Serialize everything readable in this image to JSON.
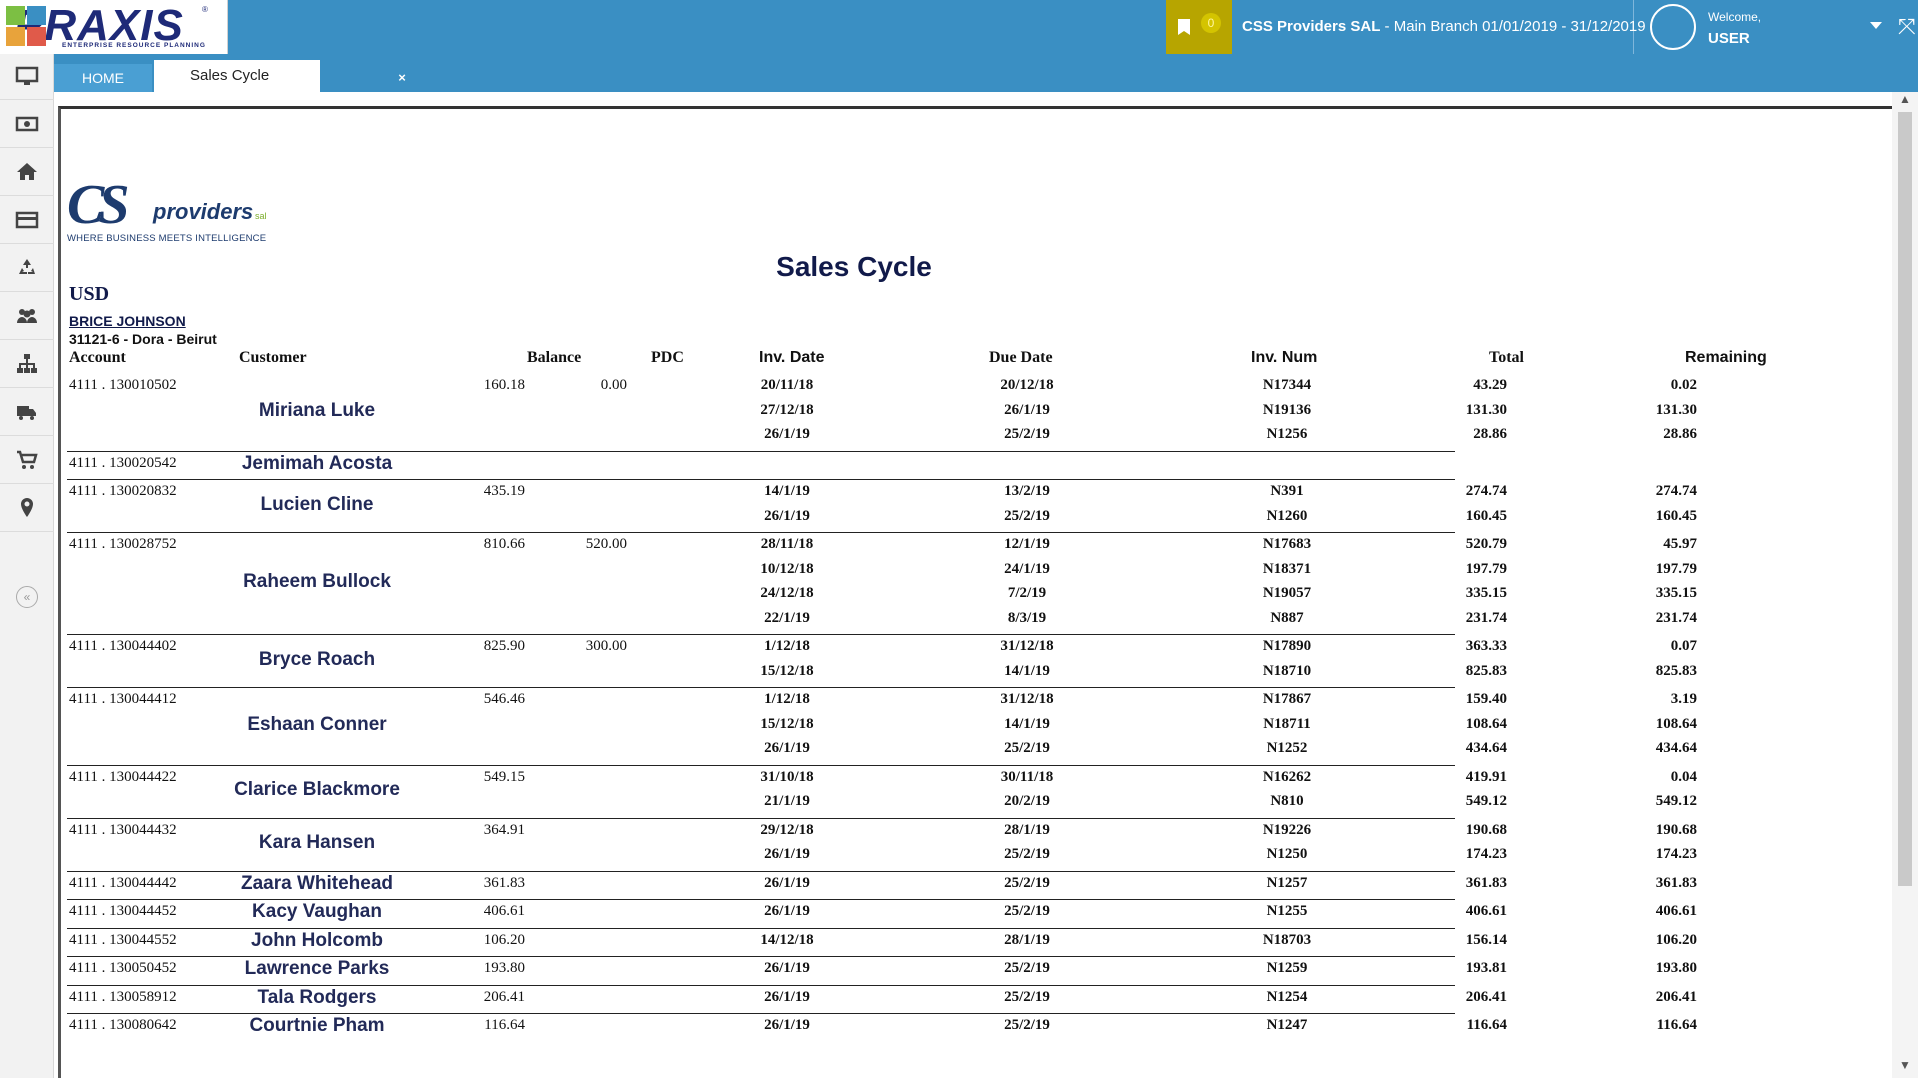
{
  "app": {
    "logo": "PRAXIS",
    "logo_sub": "ENTERPRISE RESOURCE PLANNING",
    "bookmark_count": "0",
    "company_name": "CSS Providers SAL",
    "company_detail": " - Main Branch 01/01/2019 - 31/12/2019",
    "welcome": "Welcome,",
    "user": "USER"
  },
  "tabs": {
    "home": "HOME",
    "active": "Sales Cycle",
    "close": "×"
  },
  "report": {
    "logo_mark": "CS",
    "logo_word": "providers",
    "logo_sal": "sal",
    "logo_tagline": "WHERE BUSINESS MEETS INTELLIGENCE",
    "title": "Sales Cycle",
    "currency": "USD",
    "salesman": "BRICE JOHNSON",
    "branch": "31121-6 - Dora - Beirut",
    "columns": {
      "account": "Account",
      "customer": "Customer",
      "balance": "Balance",
      "pdc": "PDC",
      "inv_date": "Inv. Date",
      "due_date": "Due Date",
      "inv_num": "Inv. Num",
      "total": "Total",
      "remaining": "Remaining"
    },
    "rows": [
      {
        "account": "4111 . 130010502",
        "customer": "Miriana Luke",
        "balance": "160.18",
        "pdc": "0.00",
        "invoices": [
          {
            "inv_date": "20/11/18",
            "due_date": "20/12/18",
            "inv_num": "N17344",
            "total": "43.29",
            "remaining": "0.02"
          },
          {
            "inv_date": "27/12/18",
            "due_date": "26/1/19",
            "inv_num": "N19136",
            "total": "131.30",
            "remaining": "131.30"
          },
          {
            "inv_date": "26/1/19",
            "due_date": "25/2/19",
            "inv_num": "N1256",
            "total": "28.86",
            "remaining": "28.86"
          }
        ]
      },
      {
        "account": "4111 . 130020542",
        "customer": "Jemimah Acosta",
        "balance": "",
        "pdc": "",
        "invoices": []
      },
      {
        "account": "4111 . 130020832",
        "customer": "Lucien Cline",
        "balance": "435.19",
        "pdc": "",
        "invoices": [
          {
            "inv_date": "14/1/19",
            "due_date": "13/2/19",
            "inv_num": "N391",
            "total": "274.74",
            "remaining": "274.74"
          },
          {
            "inv_date": "26/1/19",
            "due_date": "25/2/19",
            "inv_num": "N1260",
            "total": "160.45",
            "remaining": "160.45"
          }
        ]
      },
      {
        "account": "4111 . 130028752",
        "customer": "Raheem Bullock",
        "balance": "810.66",
        "pdc": "520.00",
        "invoices": [
          {
            "inv_date": "28/11/18",
            "due_date": "12/1/19",
            "inv_num": "N17683",
            "total": "520.79",
            "remaining": "45.97"
          },
          {
            "inv_date": "10/12/18",
            "due_date": "24/1/19",
            "inv_num": "N18371",
            "total": "197.79",
            "remaining": "197.79"
          },
          {
            "inv_date": "24/12/18",
            "due_date": "7/2/19",
            "inv_num": "N19057",
            "total": "335.15",
            "remaining": "335.15"
          },
          {
            "inv_date": "22/1/19",
            "due_date": "8/3/19",
            "inv_num": "N887",
            "total": "231.74",
            "remaining": "231.74"
          }
        ]
      },
      {
        "account": "4111 . 130044402",
        "customer": "Bryce Roach",
        "balance": "825.90",
        "pdc": "300.00",
        "invoices": [
          {
            "inv_date": "1/12/18",
            "due_date": "31/12/18",
            "inv_num": "N17890",
            "total": "363.33",
            "remaining": "0.07"
          },
          {
            "inv_date": "15/12/18",
            "due_date": "14/1/19",
            "inv_num": "N18710",
            "total": "825.83",
            "remaining": "825.83"
          }
        ]
      },
      {
        "account": "4111 . 130044412",
        "customer": "Eshaan Conner",
        "balance": "546.46",
        "pdc": "",
        "invoices": [
          {
            "inv_date": "1/12/18",
            "due_date": "31/12/18",
            "inv_num": "N17867",
            "total": "159.40",
            "remaining": "3.19"
          },
          {
            "inv_date": "15/12/18",
            "due_date": "14/1/19",
            "inv_num": "N18711",
            "total": "108.64",
            "remaining": "108.64"
          },
          {
            "inv_date": "26/1/19",
            "due_date": "25/2/19",
            "inv_num": "N1252",
            "total": "434.64",
            "remaining": "434.64"
          }
        ]
      },
      {
        "account": "4111 . 130044422",
        "customer": "Clarice Blackmore",
        "balance": "549.15",
        "pdc": "",
        "invoices": [
          {
            "inv_date": "31/10/18",
            "due_date": "30/11/18",
            "inv_num": "N16262",
            "total": "419.91",
            "remaining": "0.04"
          },
          {
            "inv_date": "21/1/19",
            "due_date": "20/2/19",
            "inv_num": "N810",
            "total": "549.12",
            "remaining": "549.12"
          }
        ]
      },
      {
        "account": "4111 . 130044432",
        "customer": "Kara Hansen",
        "balance": "364.91",
        "pdc": "",
        "invoices": [
          {
            "inv_date": "29/12/18",
            "due_date": "28/1/19",
            "inv_num": "N19226",
            "total": "190.68",
            "remaining": "190.68"
          },
          {
            "inv_date": "26/1/19",
            "due_date": "25/2/19",
            "inv_num": "N1250",
            "total": "174.23",
            "remaining": "174.23"
          }
        ]
      },
      {
        "account": "4111 . 130044442",
        "customer": "Zaara Whitehead",
        "balance": "361.83",
        "pdc": "",
        "invoices": [
          {
            "inv_date": "26/1/19",
            "due_date": "25/2/19",
            "inv_num": "N1257",
            "total": "361.83",
            "remaining": "361.83"
          }
        ]
      },
      {
        "account": "4111 . 130044452",
        "customer": "Kacy Vaughan",
        "balance": "406.61",
        "pdc": "",
        "invoices": [
          {
            "inv_date": "26/1/19",
            "due_date": "25/2/19",
            "inv_num": "N1255",
            "total": "406.61",
            "remaining": "406.61"
          }
        ]
      },
      {
        "account": "4111 . 130044552",
        "customer": "John Holcomb",
        "balance": "106.20",
        "pdc": "",
        "invoices": [
          {
            "inv_date": "14/12/18",
            "due_date": "28/1/19",
            "inv_num": "N18703",
            "total": "156.14",
            "remaining": "106.20"
          }
        ]
      },
      {
        "account": "4111 . 130050452",
        "customer": "Lawrence Parks",
        "balance": "193.80",
        "pdc": "",
        "invoices": [
          {
            "inv_date": "26/1/19",
            "due_date": "25/2/19",
            "inv_num": "N1259",
            "total": "193.81",
            "remaining": "193.80"
          }
        ]
      },
      {
        "account": "4111 . 130058912",
        "customer": "Tala Rodgers",
        "balance": "206.41",
        "pdc": "",
        "invoices": [
          {
            "inv_date": "26/1/19",
            "due_date": "25/2/19",
            "inv_num": "N1254",
            "total": "206.41",
            "remaining": "206.41"
          }
        ]
      },
      {
        "account": "4111 . 130080642",
        "customer": "Courtnie Pham",
        "balance": "116.64",
        "pdc": "",
        "invoices": [
          {
            "inv_date": "26/1/19",
            "due_date": "25/2/19",
            "inv_num": "N1247",
            "total": "116.64",
            "remaining": "116.64"
          }
        ]
      }
    ]
  },
  "colors": {
    "brand_blue": "#3a8fc3",
    "bookmark_gold": "#b7a500",
    "text_navy": "#111a4a"
  },
  "sidebar": {
    "icons": [
      "monitor-icon",
      "cash-icon",
      "home-icon",
      "credit-card-icon",
      "recycle-icon",
      "users-icon",
      "org-chart-icon",
      "truck-icon",
      "cart-icon",
      "location-pin-icon"
    ],
    "collapse": "«"
  }
}
